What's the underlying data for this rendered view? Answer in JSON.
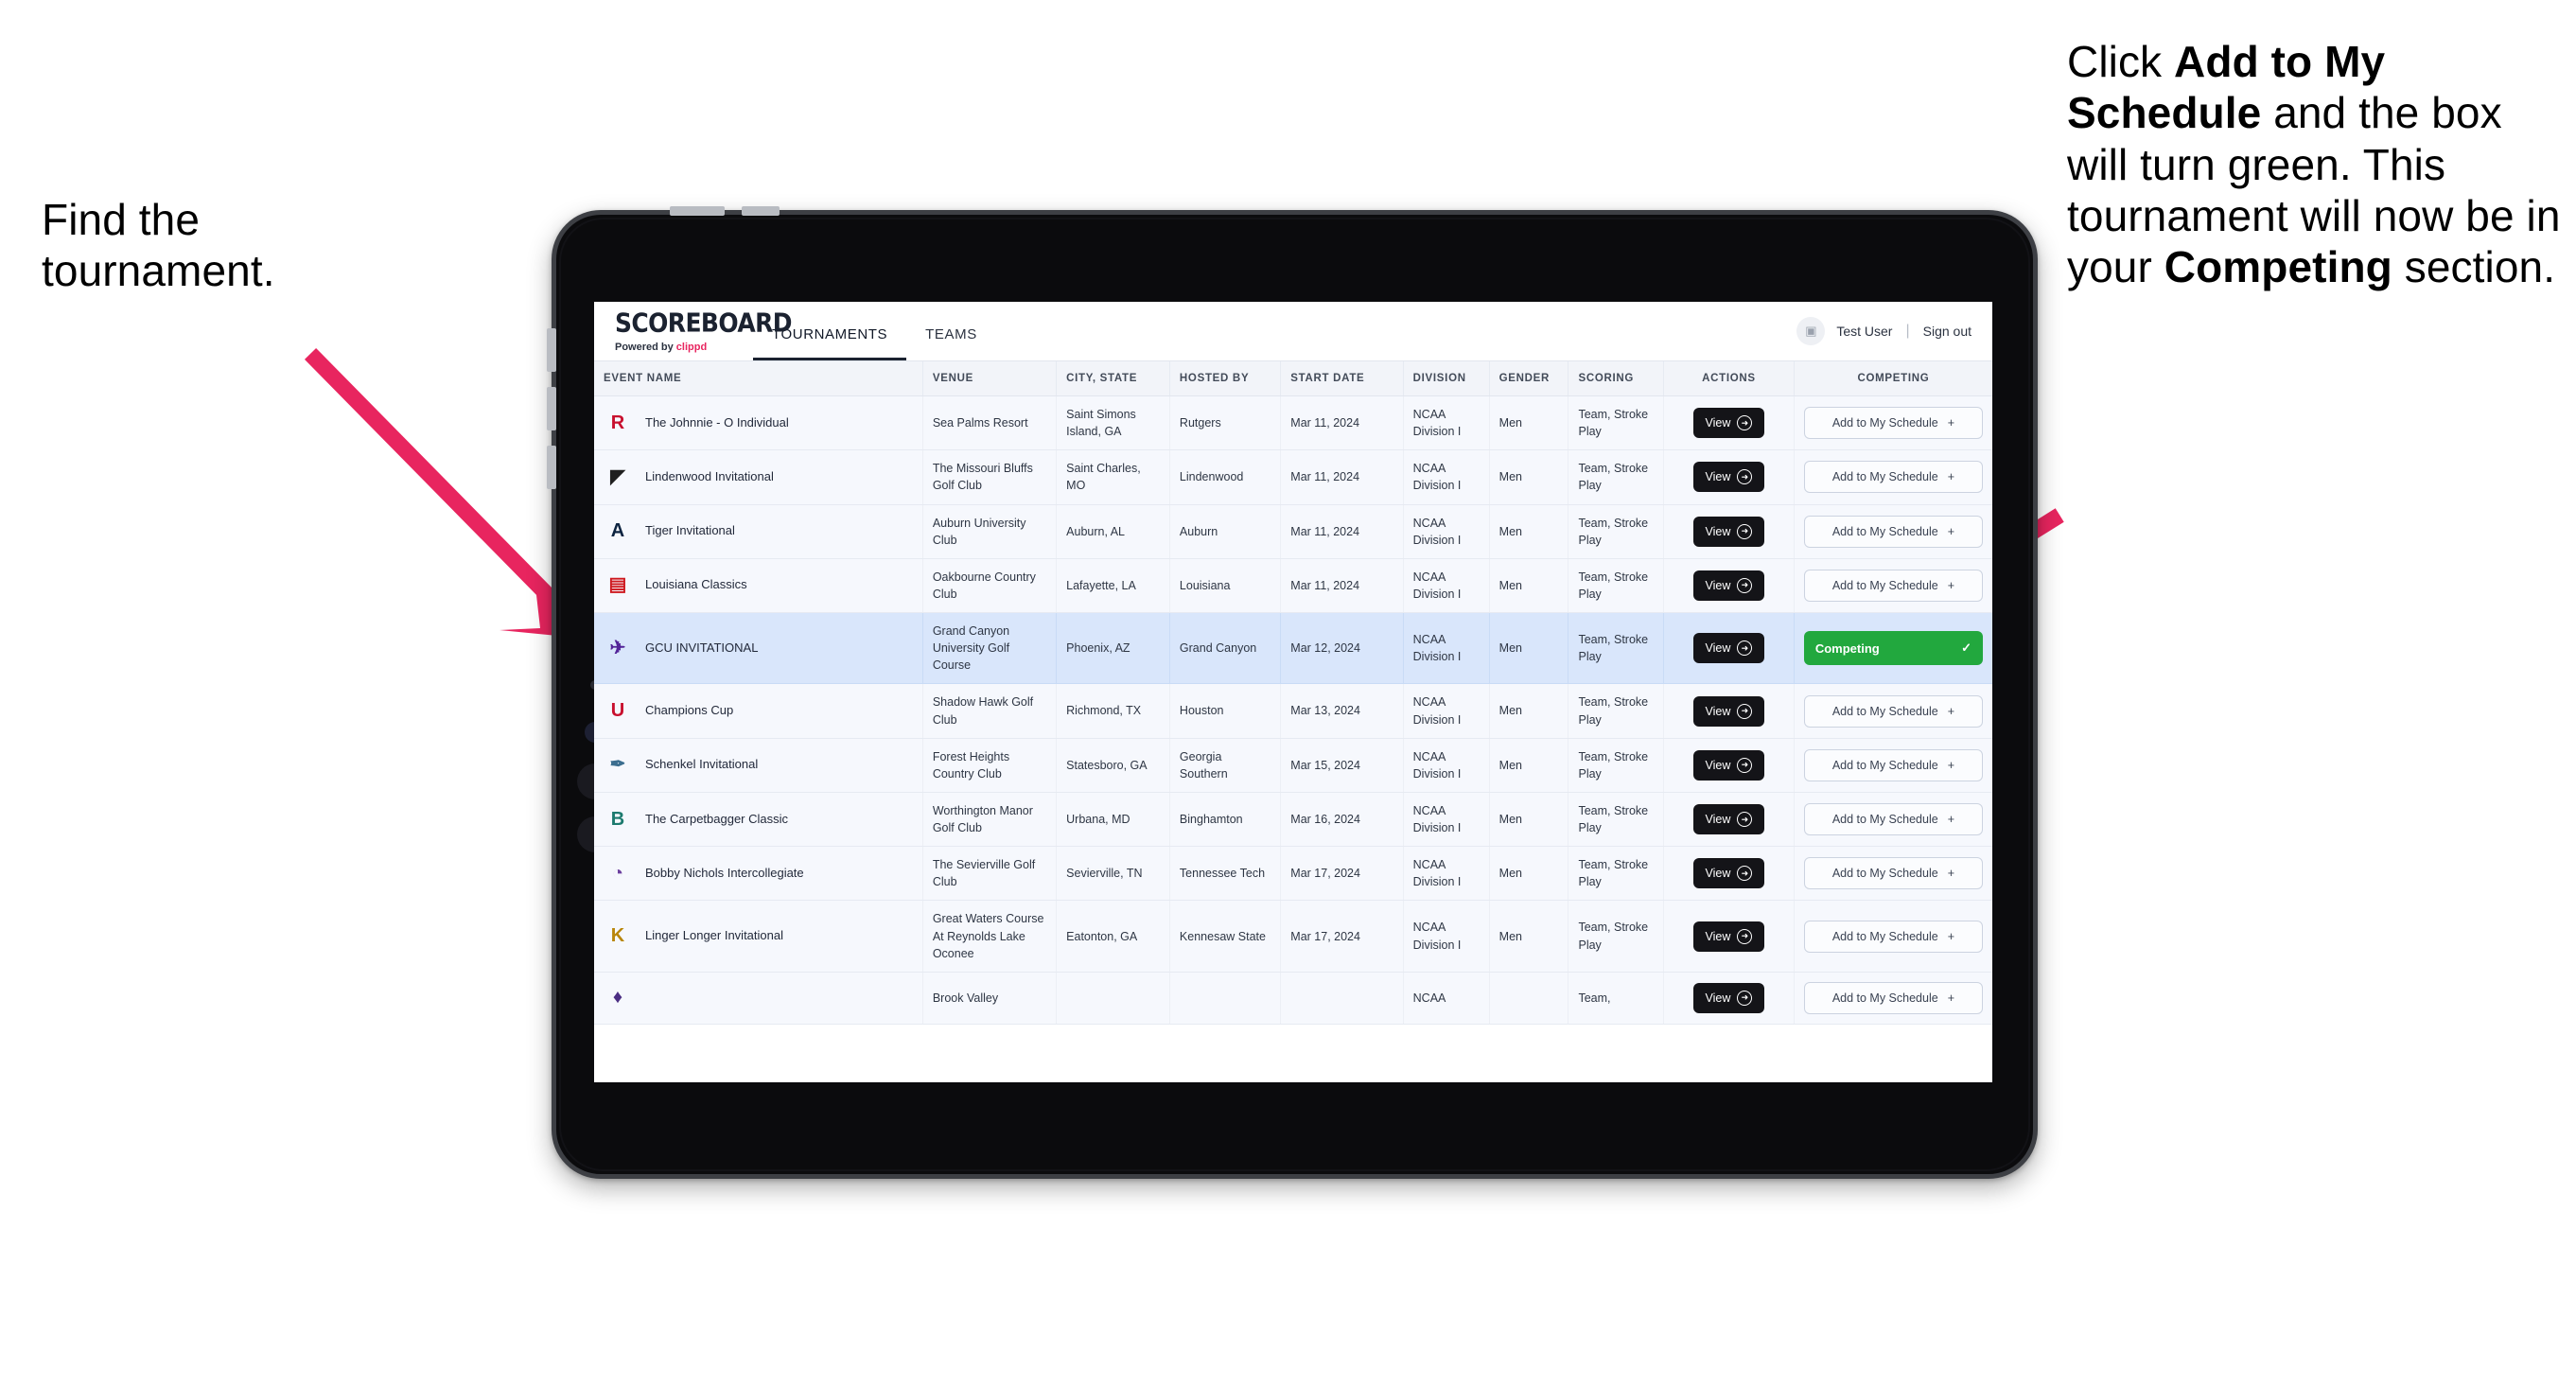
{
  "annotations": {
    "left": {
      "line1": "Find the",
      "line2": "tournament."
    },
    "right": {
      "seg1": "Click ",
      "seg2_bold": "Add to My Schedule",
      "seg3": " and the box will turn green. This tournament will now be in your ",
      "seg4_bold": "Competing",
      "seg5": " section."
    },
    "arrow_color": "#e8255f"
  },
  "app": {
    "brand": {
      "title": "SCOREBOARD",
      "powered_prefix": "Powered by ",
      "powered_name": "clippd"
    },
    "nav": [
      {
        "label": "TOURNAMENTS",
        "active": true
      },
      {
        "label": "TEAMS",
        "active": false
      }
    ],
    "user": {
      "avatar_icon": "user-badge-icon",
      "name": "Test User",
      "separator": "|",
      "sign_out": "Sign out"
    },
    "table": {
      "columns": [
        "EVENT NAME",
        "VENUE",
        "CITY, STATE",
        "HOSTED BY",
        "START DATE",
        "DIVISION",
        "GENDER",
        "SCORING",
        "ACTIONS",
        "COMPETING"
      ],
      "view_label": "View",
      "view_icon": "arrow-right-circle-icon",
      "add_label": "Add to My Schedule",
      "add_icon": "plus-icon",
      "competing_label": "Competing",
      "competing_icon": "check-icon",
      "competing_color": "#22a83e",
      "rows": [
        {
          "logo": "R",
          "logo_color": "#c8102e",
          "event": "The Johnnie - O Individual",
          "venue": "Sea Palms Resort",
          "city": "Saint Simons Island, GA",
          "hosted_by": "Rutgers",
          "start_date": "Mar 11, 2024",
          "division": "NCAA Division I",
          "gender": "Men",
          "scoring": "Team, Stroke Play",
          "competing": false
        },
        {
          "logo": "◤",
          "logo_color": "#1f1f1f",
          "event": "Lindenwood Invitational",
          "venue": "The Missouri Bluffs Golf Club",
          "city": "Saint Charles, MO",
          "hosted_by": "Lindenwood",
          "start_date": "Mar 11, 2024",
          "division": "NCAA Division I",
          "gender": "Men",
          "scoring": "Team, Stroke Play",
          "competing": false
        },
        {
          "logo": "A",
          "logo_color": "#0c2340",
          "event": "Tiger Invitational",
          "venue": "Auburn University Club",
          "city": "Auburn, AL",
          "hosted_by": "Auburn",
          "start_date": "Mar 11, 2024",
          "division": "NCAA Division I",
          "gender": "Men",
          "scoring": "Team, Stroke Play",
          "competing": false
        },
        {
          "logo": "▤",
          "logo_color": "#ce181e",
          "event": "Louisiana Classics",
          "venue": "Oakbourne Country Club",
          "city": "Lafayette, LA",
          "hosted_by": "Louisiana",
          "start_date": "Mar 11, 2024",
          "division": "NCAA Division I",
          "gender": "Men",
          "scoring": "Team, Stroke Play",
          "competing": false
        },
        {
          "logo": "✈",
          "logo_color": "#522398",
          "event": "GCU INVITATIONAL",
          "venue": "Grand Canyon University Golf Course",
          "city": "Phoenix, AZ",
          "hosted_by": "Grand Canyon",
          "start_date": "Mar 12, 2024",
          "division": "NCAA Division I",
          "gender": "Men",
          "scoring": "Team, Stroke Play",
          "competing": true
        },
        {
          "logo": "U",
          "logo_color": "#c8102e",
          "event": "Champions Cup",
          "venue": "Shadow Hawk Golf Club",
          "city": "Richmond, TX",
          "hosted_by": "Houston",
          "start_date": "Mar 13, 2024",
          "division": "NCAA Division I",
          "gender": "Men",
          "scoring": "Team, Stroke Play",
          "competing": false
        },
        {
          "logo": "✒",
          "logo_color": "#3b6e8f",
          "event": "Schenkel Invitational",
          "venue": "Forest Heights Country Club",
          "city": "Statesboro, GA",
          "hosted_by": "Georgia Southern",
          "start_date": "Mar 15, 2024",
          "division": "NCAA Division I",
          "gender": "Men",
          "scoring": "Team, Stroke Play",
          "competing": false
        },
        {
          "logo": "B",
          "logo_color": "#1c7a6e",
          "event": "The Carpetbagger Classic",
          "venue": "Worthington Manor Golf Club",
          "city": "Urbana, MD",
          "hosted_by": "Binghamton",
          "start_date": "Mar 16, 2024",
          "division": "NCAA Division I",
          "gender": "Men",
          "scoring": "Team, Stroke Play",
          "competing": false
        },
        {
          "logo": "◔",
          "logo_color": "#6b3f9e",
          "event": "Bobby Nichols Intercollegiate",
          "venue": "The Sevierville Golf Club",
          "city": "Sevierville, TN",
          "hosted_by": "Tennessee Tech",
          "start_date": "Mar 17, 2024",
          "division": "NCAA Division I",
          "gender": "Men",
          "scoring": "Team, Stroke Play",
          "competing": false
        },
        {
          "logo": "K",
          "logo_color": "#b8860b",
          "event": "Linger Longer Invitational",
          "venue": "Great Waters Course At Reynolds Lake Oconee",
          "city": "Eatonton, GA",
          "hosted_by": "Kennesaw State",
          "start_date": "Mar 17, 2024",
          "division": "NCAA Division I",
          "gender": "Men",
          "scoring": "Team, Stroke Play",
          "competing": false
        },
        {
          "logo": "♦",
          "logo_color": "#4b2e83",
          "event": "",
          "venue": "Brook Valley",
          "city": "",
          "hosted_by": "",
          "start_date": "",
          "division": "NCAA",
          "gender": "",
          "scoring": "Team,",
          "competing": false
        }
      ]
    }
  }
}
